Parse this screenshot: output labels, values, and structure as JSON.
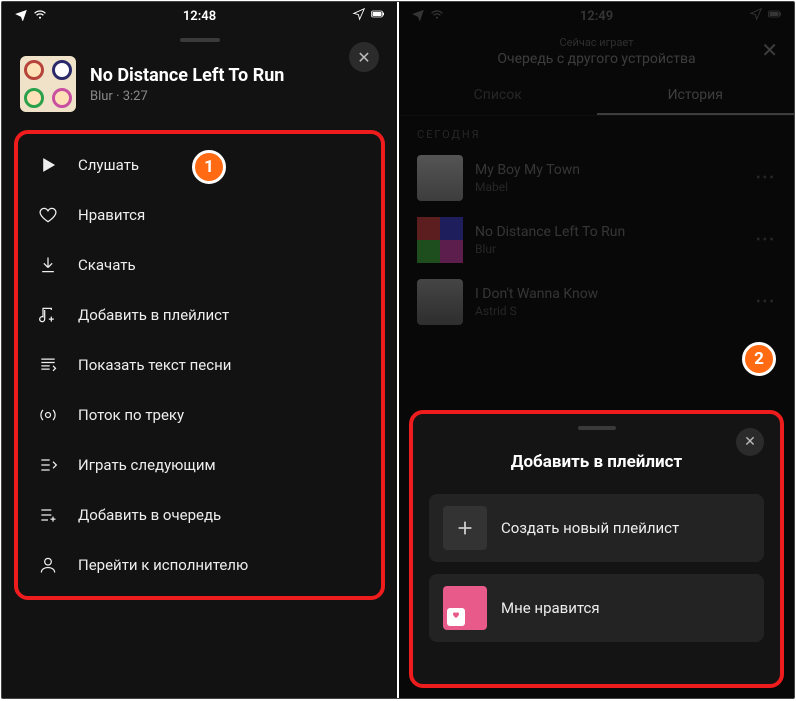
{
  "left": {
    "status": {
      "time": "12:48"
    },
    "track": {
      "title": "No Distance Left To Run",
      "artist": "Blur",
      "duration": "3:27"
    },
    "menu": [
      {
        "icon": "play-icon",
        "label": "Слушать"
      },
      {
        "icon": "heart-icon",
        "label": "Нравится"
      },
      {
        "icon": "download-icon",
        "label": "Скачать"
      },
      {
        "icon": "playlist-add-icon",
        "label": "Добавить в плейлист"
      },
      {
        "icon": "lyrics-icon",
        "label": "Показать текст песни"
      },
      {
        "icon": "radio-icon",
        "label": "Поток по треку"
      },
      {
        "icon": "play-next-icon",
        "label": "Играть следующим"
      },
      {
        "icon": "queue-add-icon",
        "label": "Добавить в очередь"
      },
      {
        "icon": "artist-icon",
        "label": "Перейти к исполнителю"
      }
    ]
  },
  "right": {
    "status": {
      "time": "12:49"
    },
    "header": {
      "subtitle": "Сейчас играет",
      "title": "Очередь с другого устройства"
    },
    "tabs": {
      "list": "Список",
      "history": "История"
    },
    "section_today": "СЕГОДНЯ",
    "history": [
      {
        "title": "My Boy My Town",
        "artist": "Mabel"
      },
      {
        "title": "No Distance Left To Run",
        "artist": "Blur"
      },
      {
        "title": "I Don't Wanna Know",
        "artist": "Astrid S"
      }
    ],
    "sheet": {
      "title": "Добавить в плейлист",
      "create": "Создать новый плейлист",
      "liked": "Мне нравится"
    }
  },
  "annotations": {
    "one": "1",
    "two": "2"
  }
}
